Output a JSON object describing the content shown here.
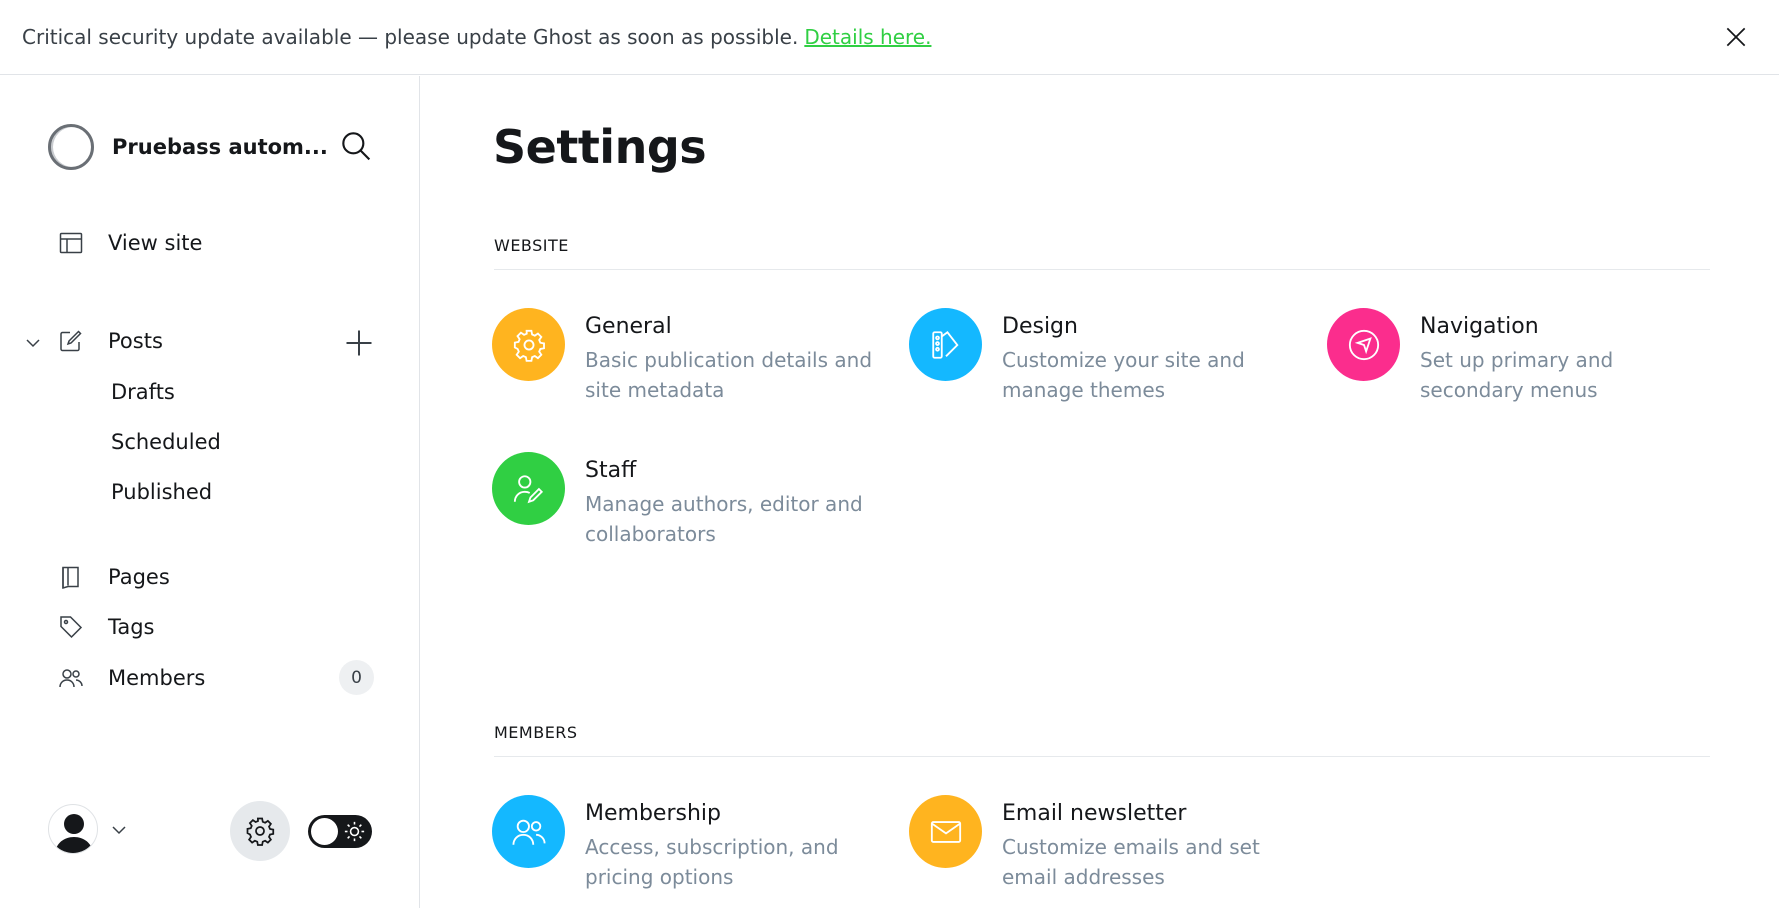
{
  "banner": {
    "message": "Critical security update available — please update Ghost as soon as possible.",
    "link_label": "Details here."
  },
  "sidebar": {
    "site_name": "Pruebass autom...",
    "view_site": "View site",
    "posts": "Posts",
    "posts_sub": [
      "Drafts",
      "Scheduled",
      "Published"
    ],
    "pages": "Pages",
    "tags": "Tags",
    "members": "Members",
    "members_count": "0"
  },
  "main": {
    "title": "Settings",
    "sections": [
      {
        "heading": "WEBSITE",
        "cards": [
          {
            "title": "General",
            "desc": "Basic publication details and site metadata",
            "color": "#ffb41f",
            "icon": "gear-icon"
          },
          {
            "title": "Design",
            "desc": "Customize your site and manage themes",
            "color": "#14b8ff",
            "icon": "palette-icon"
          },
          {
            "title": "Navigation",
            "desc": "Set up primary and secondary menus",
            "color": "#fb2d8d",
            "icon": "compass-icon"
          },
          {
            "title": "Staff",
            "desc": "Manage authors, editor and collaborators",
            "color": "#30cf43",
            "icon": "user-edit-icon"
          }
        ]
      },
      {
        "heading": "MEMBERS",
        "cards": [
          {
            "title": "Membership",
            "desc": "Access, subscription, and pricing options",
            "color": "#14b8ff",
            "icon": "members-icon"
          },
          {
            "title": "Email newsletter",
            "desc": "Customize emails and set email addresses",
            "color": "#ffb41f",
            "icon": "envelope-icon"
          }
        ]
      }
    ]
  }
}
